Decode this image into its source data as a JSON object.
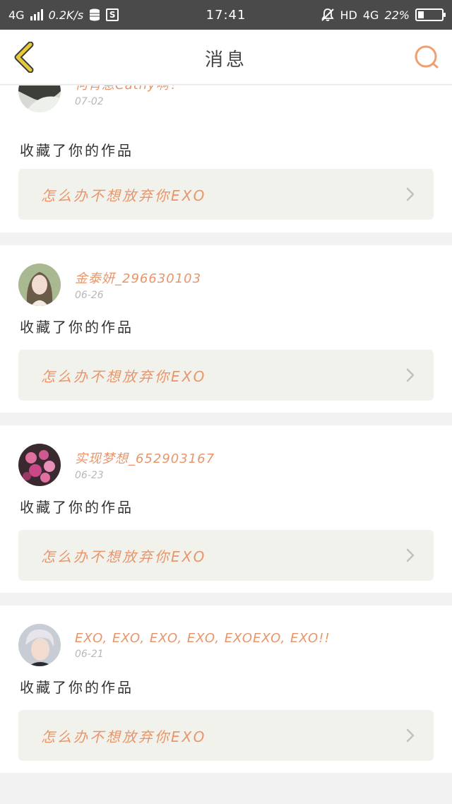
{
  "status_bar": {
    "network": "4G",
    "speed": "0.2K/s",
    "s_badge": "S",
    "time": "17:41",
    "hd": "HD",
    "network2": "4G",
    "battery_percent_text": "22%",
    "battery_level": 0.22,
    "icons": [
      "signal-icon",
      "database-icon",
      "s-square-icon",
      "mute-bell-icon",
      "battery-icon"
    ]
  },
  "nav": {
    "title": "消息",
    "back_icon": "chevron-left-icon",
    "search_icon": "search-icon",
    "accent_color": "#e8956a",
    "back_color": "#e8c93a"
  },
  "messages": [
    {
      "username": "何宵蒽Cathy啊！",
      "date": "07-02",
      "action": "收藏了你的作品",
      "work_title": "怎么办不想放弃你EXO"
    },
    {
      "username": "金泰妍_296630103",
      "date": "06-26",
      "action": "收藏了你的作品",
      "work_title": "怎么办不想放弃你EXO"
    },
    {
      "username": "实现梦想_652903167",
      "date": "06-23",
      "action": "收藏了你的作品",
      "work_title": "怎么办不想放弃你EXO"
    },
    {
      "username": "EXO, EXO, EXO, EXO, EXOEXO, EXO!!",
      "date": "06-21",
      "action": "收藏了你的作品",
      "work_title": "怎么办不想放弃你EXO"
    }
  ]
}
